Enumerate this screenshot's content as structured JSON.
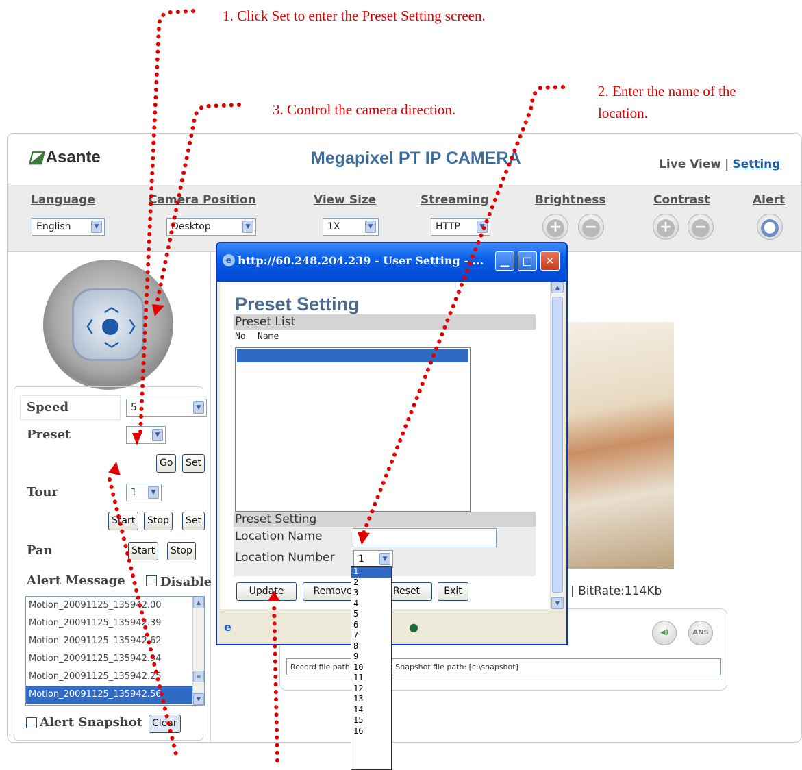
{
  "annotations": {
    "step1": "1. Click Set to enter the Preset Setting screen.",
    "step2_line1": "2. Enter the name of the",
    "step2_line2": "location.",
    "step3": "3. Control the camera direction."
  },
  "header": {
    "logo": "Asante",
    "title": "Megapixel PT IP CAMERA",
    "nav_live": "Live View",
    "nav_sep": "|",
    "nav_setting": "Setting"
  },
  "toolbar": {
    "language_label": "Language",
    "language_value": "English",
    "camera_position_label": "Camera Position",
    "camera_position_value": "Desktop",
    "view_size_label": "View Size",
    "view_size_value": "1X",
    "streaming_label": "Streaming",
    "streaming_value": "HTTP",
    "brightness_label": "Brightness",
    "contrast_label": "Contrast",
    "alert_label": "Alert"
  },
  "controls": {
    "speed_label": "Speed",
    "speed_value": "5",
    "preset_label": "Preset",
    "preset_value": "",
    "go_label": "Go",
    "set_label": "Set",
    "tour_label": "Tour",
    "tour_value": "1",
    "start_label": "Start",
    "stop_label": "Stop",
    "tour_set_label": "Set",
    "pan_label": "Pan",
    "pan_start_label": "Start",
    "pan_stop_label": "Stop",
    "alert_message_label": "Alert Message",
    "disable_label": "Disable",
    "alert_items": [
      "Motion_20091125_135942.00",
      "Motion_20091125_135942.39",
      "Motion_20091125_135942.62",
      "Motion_20091125_135942.94",
      "Motion_20091125_135942.25",
      "Motion_20091125_135942.56"
    ],
    "alert_snapshot_label": "Alert Snapshot",
    "clear_label": "Clear"
  },
  "content": {
    "bitrate": "| BitRate:114Kb",
    "record_info": "Record file path: [c:\\video]; Snapshot file path: [c:\\snapshot]",
    "ans_label": "ANS"
  },
  "popup": {
    "title": "http://60.248.204.239 - User Setting - ...",
    "heading": "Preset Setting",
    "list_section": "Preset List",
    "col_no": "No",
    "col_name": "Name",
    "setting_section": "Preset Setting",
    "location_name_label": "Location Name",
    "location_name_value": "",
    "location_number_label": "Location Number",
    "location_number_value": "1",
    "update_label": "Update",
    "remove_label": "Remove",
    "reset_label": "Reset",
    "exit_label": "Exit",
    "location_options": [
      "1",
      "2",
      "3",
      "4",
      "5",
      "6",
      "7",
      "8",
      "9",
      "10",
      "11",
      "12",
      "13",
      "14",
      "15",
      "16"
    ]
  },
  "colors": {
    "annotation": "#e00000",
    "title_blue": "#3e6d9c",
    "link_blue": "#1c5fb0",
    "xp_title": "#0a5fe8",
    "selection": "#316ac5"
  }
}
